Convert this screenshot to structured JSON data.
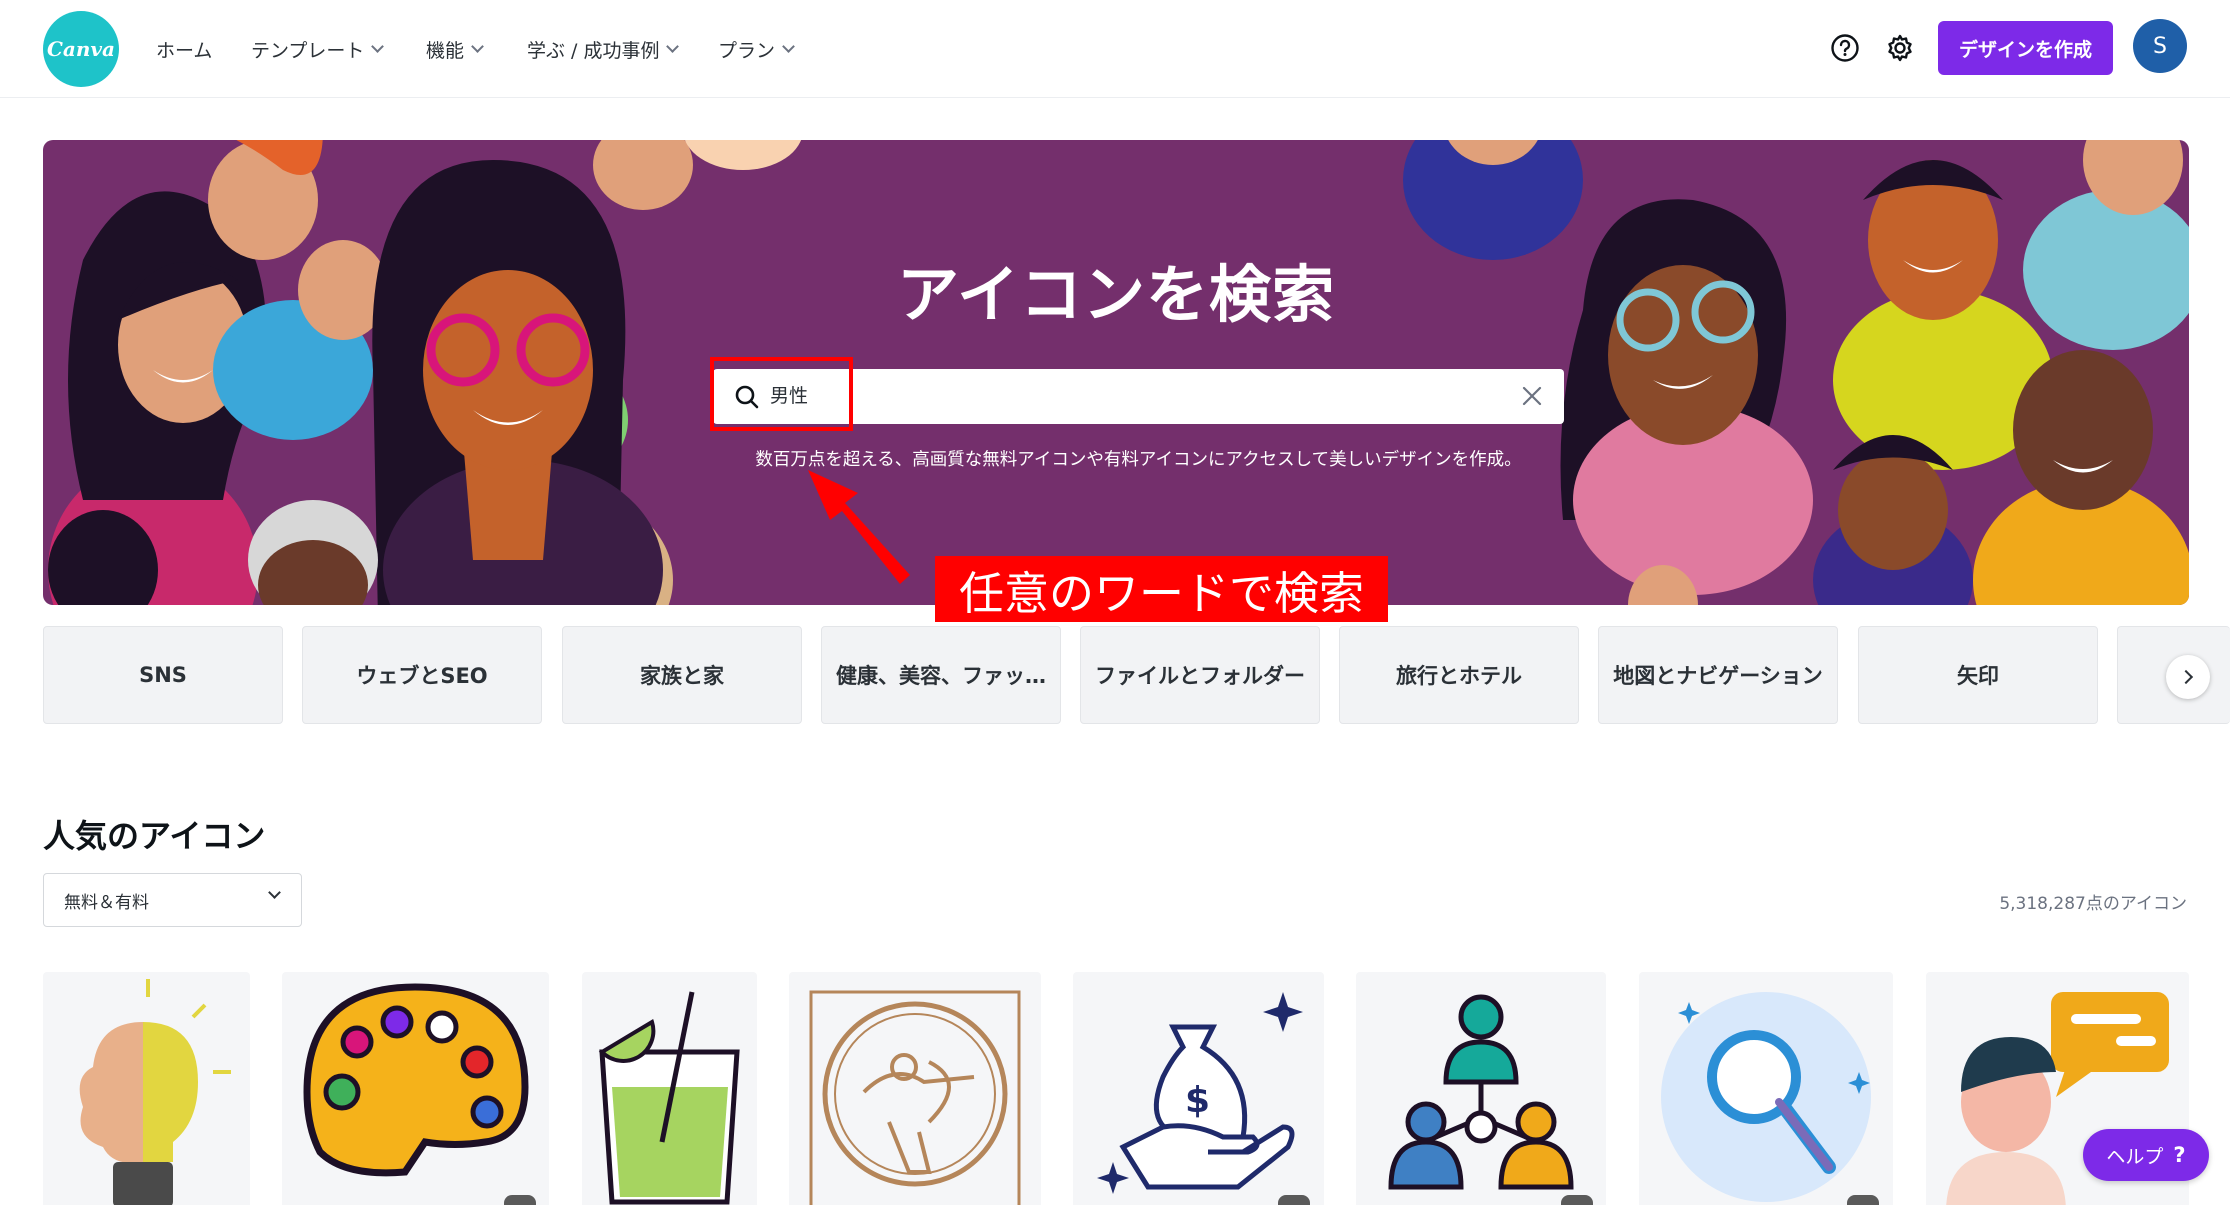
{
  "brand": {
    "logo_text": "Canva",
    "accent": "#7d2ae8",
    "hero_bg": "#742f6c"
  },
  "nav": {
    "items": [
      {
        "label": "ホーム",
        "has_dropdown": false
      },
      {
        "label": "テンプレート",
        "has_dropdown": true
      },
      {
        "label": "機能",
        "has_dropdown": true
      },
      {
        "label": "学ぶ / 成功事例",
        "has_dropdown": true
      },
      {
        "label": "プラン",
        "has_dropdown": true
      }
    ],
    "help_icon": "question-circle-icon",
    "settings_icon": "gear-icon",
    "create_button": "デザインを作成",
    "avatar_initial": "S"
  },
  "hero": {
    "title": "アイコンを検索",
    "search_value": "男性",
    "subtitle": "数百万点を超える、高画質な無料アイコンや有料アイコンにアクセスして美しいデザインを作成。",
    "annotation": "任意のワードで検索"
  },
  "categories": [
    "SNS",
    "ウェブとSEO",
    "家族と家",
    "健康、美容、ファッ…",
    "ファイルとフォルダー",
    "旅行とホテル",
    "地図とナビゲーション",
    "矢印",
    ""
  ],
  "popular": {
    "title": "人気のアイコン",
    "filter_value": "無料＆有料",
    "count": "5,318,287点のアイコン",
    "icons": [
      "brain-bulb-icon",
      "paint-palette-icon",
      "cocktail-glass-icon",
      "archer-emblem-icon",
      "money-bag-hand-icon",
      "people-network-icon",
      "magnifier-icon",
      "person-chat-icon"
    ]
  },
  "help_button": {
    "label": "ヘルプ",
    "glyph": "?"
  }
}
